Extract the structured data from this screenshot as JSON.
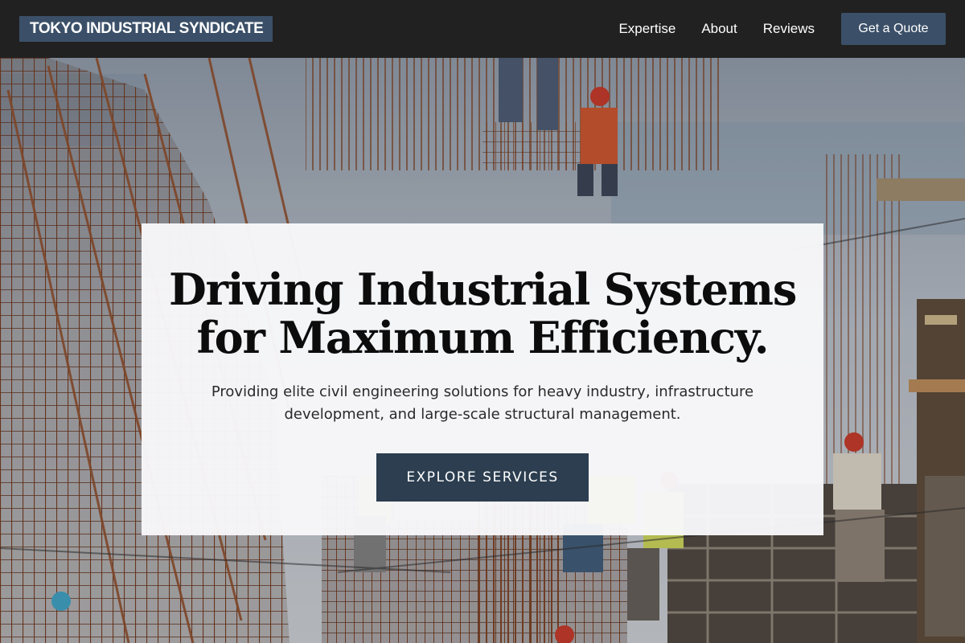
{
  "brand": {
    "name": "TOKYO INDUSTRIAL SYNDICATE"
  },
  "nav": {
    "links": [
      "Expertise",
      "About",
      "Reviews"
    ],
    "cta_label": "Get a Quote"
  },
  "hero": {
    "headline_line1": "Driving Industrial Systems",
    "headline_line2": "for Maximum Efficiency.",
    "subtext": "Providing elite civil engineering solutions for heavy industry, infrastructure development, and large-scale structural management.",
    "cta_label": "EXPLORE SERVICES",
    "background": "construction workers on rebar scaffolding"
  },
  "colors": {
    "nav_bg": "#212121",
    "brand_accent": "#3b5068",
    "cta_bg": "#2c3e50",
    "card_bg": "#f8f8fa",
    "rebar": "#8a4a2a"
  }
}
